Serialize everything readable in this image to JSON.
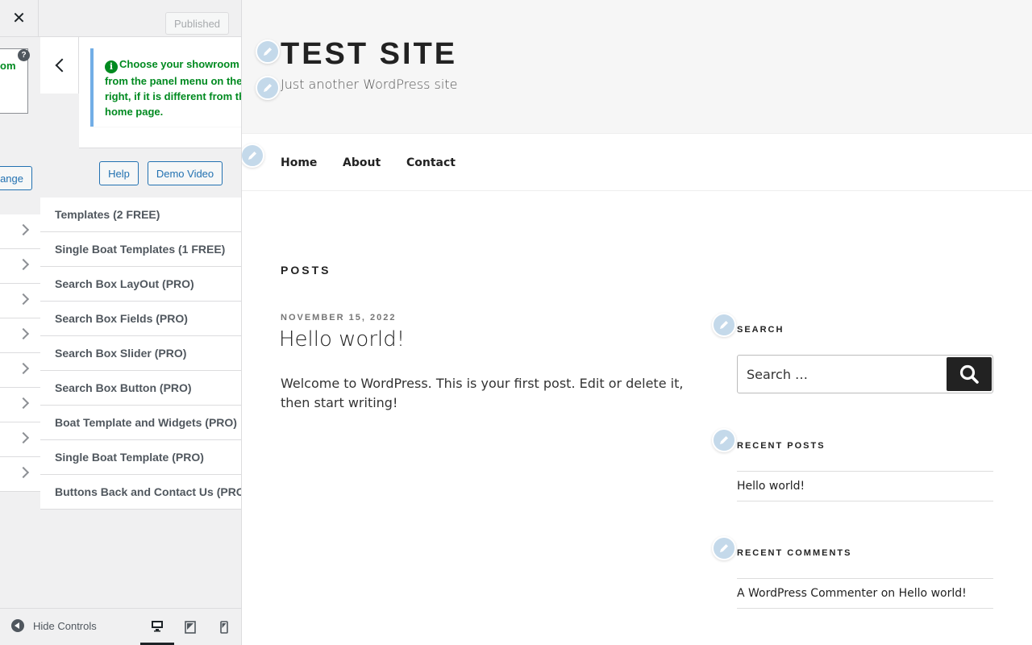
{
  "topbar": {
    "close_icon": "close-icon",
    "published_label": "Published"
  },
  "outer_panel": {
    "notice_fragment": "om",
    "change_button_fragment": "ange"
  },
  "section": {
    "notice": "Choose your showroom page from the panel menu on the right, if it is different from the home page.",
    "help_label": "Help",
    "demo_video_label": "Demo Video",
    "menu_items": [
      "Templates (2 FREE)",
      "Single Boat Templates (1 FREE)",
      "Search Box LayOut (PRO)",
      "Search Box Fields (PRO)",
      "Search Box Slider (PRO)",
      "Search Box Button (PRO)",
      "Boat Template and Widgets (PRO)",
      "Single Boat Template (PRO)",
      "Buttons Back and Contact Us (PRO)"
    ]
  },
  "footer": {
    "hide_controls_label": "Hide Controls",
    "devices": [
      "desktop-icon",
      "tablet-icon",
      "mobile-icon"
    ]
  },
  "site": {
    "title": "TEST SITE",
    "tagline": "Just another WordPress site",
    "nav": [
      "Home",
      "About",
      "Contact"
    ],
    "posts_heading": "POSTS",
    "post": {
      "date": "NOVEMBER 15, 2022",
      "title": "Hello world!",
      "excerpt": "Welcome to WordPress. This is your first post. Edit or delete it, then start writing!"
    },
    "widgets": {
      "search_title": "SEARCH",
      "search_placeholder": "Search …",
      "recent_posts_title": "RECENT POSTS",
      "recent_posts": [
        "Hello world!"
      ],
      "recent_comments_title": "RECENT COMMENTS",
      "comment_author": "A WordPress Commenter",
      "comment_on": "on",
      "comment_post": "Hello world!"
    }
  },
  "colors": {
    "accent": "#2271b1",
    "notice_text": "#008a20",
    "notice_border": "#72aee6",
    "edit_shortcut": "#c4d9ea"
  }
}
